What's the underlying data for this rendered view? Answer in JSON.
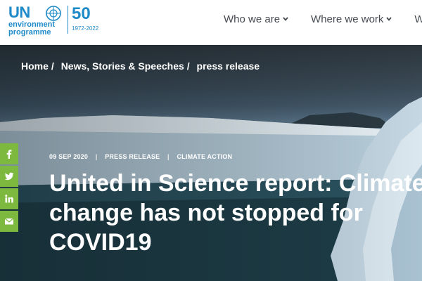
{
  "logo": {
    "un": "UN",
    "line1": "environment",
    "line2": "programme",
    "fifty": "50",
    "years": "1972-2022"
  },
  "nav": {
    "items": [
      {
        "label": "Who we are"
      },
      {
        "label": "Where we work"
      },
      {
        "label": "Wha"
      }
    ]
  },
  "breadcrumb": {
    "items": [
      "Home",
      "News, Stories & Speeches",
      "press release"
    ],
    "separator": "/"
  },
  "article": {
    "date": "09 SEP 2020",
    "type": "PRESS RELEASE",
    "topic": "CLIMATE ACTION",
    "meta_separator": "|",
    "title": "United in Science report: Climate change has not stopped for COVID19"
  },
  "social": {
    "items": [
      "facebook-icon",
      "twitter-icon",
      "linkedin-icon",
      "email-icon"
    ],
    "color": "#7db93e"
  },
  "colors": {
    "brand": "#1e8ac8",
    "nav_text": "#444a50",
    "accent": "#7db93e"
  }
}
